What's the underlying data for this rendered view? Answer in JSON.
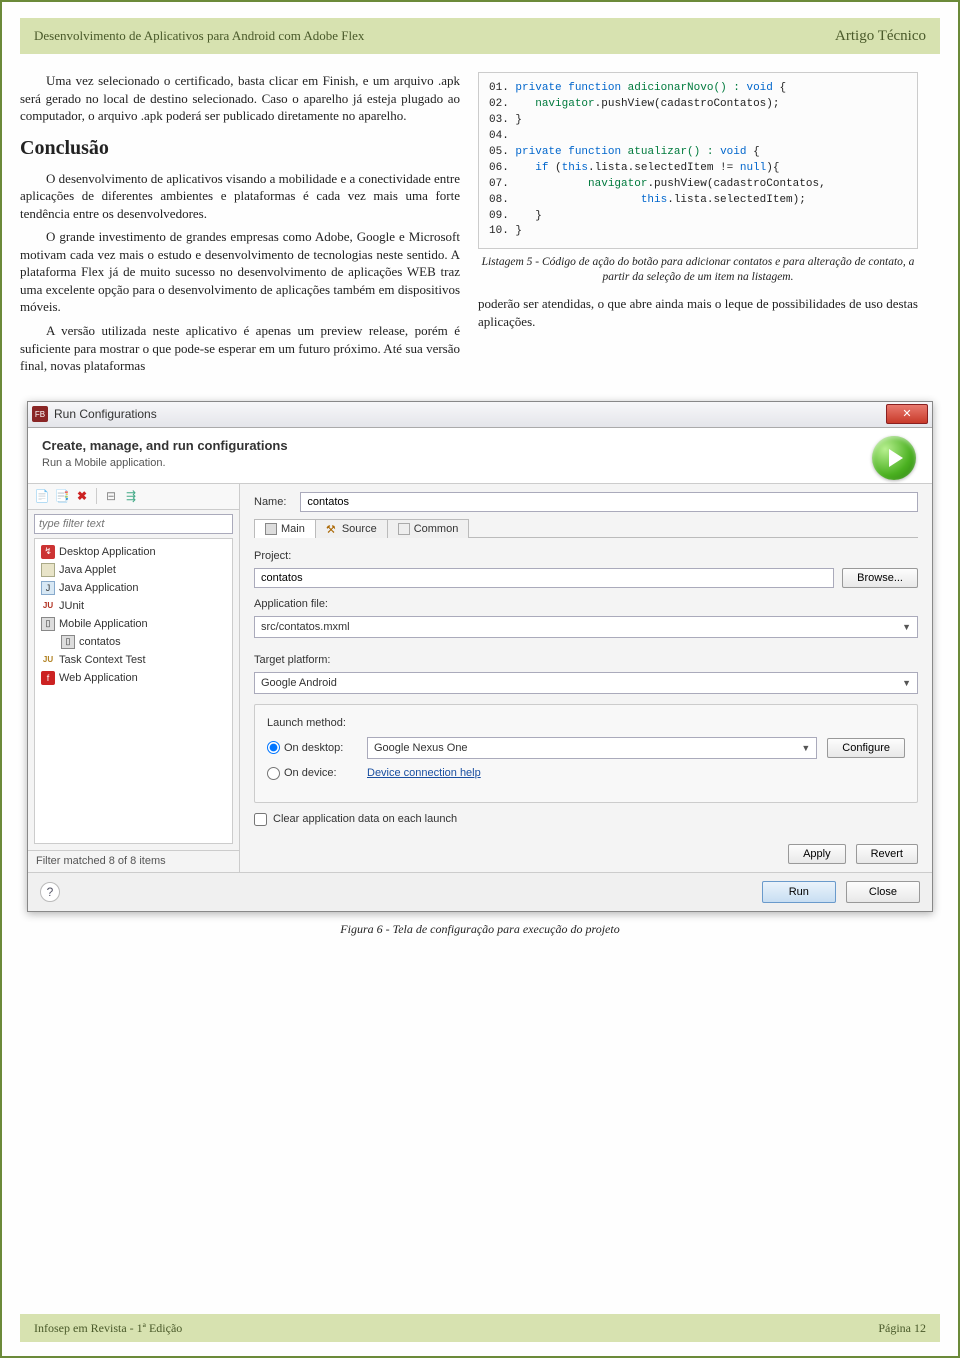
{
  "header": {
    "left": "Desenvolvimento de Aplicativos para Android com Adobe Flex",
    "right": "Artigo Técnico"
  },
  "left_col": {
    "p1": "Uma vez selecionado o certificado, basta clicar em Finish, e um arquivo .apk será gerado no local de destino selecionado. Caso o aparelho já esteja plugado ao computador, o arquivo .apk poderá ser publicado diretamente no aparelho.",
    "h2": "Conclusão",
    "p2": "O desenvolvimento de aplicativos visando a mobilidade e a conectividade entre aplicações de diferentes ambientes e plataformas é cada vez mais uma forte tendência entre os desenvolvedores.",
    "p3": "O grande investimento de grandes empresas como Adobe, Google e Microsoft motivam cada vez mais o estudo e desenvolvimento de tecnologias neste sentido. A plataforma Flex já de muito sucesso no desenvolvimento de aplicações WEB traz uma excelente opção para o desenvolvimento de aplicações também em dispositivos móveis.",
    "p4": "A versão utilizada neste aplicativo é apenas um preview release, porém é suficiente para mostrar o que pode-se esperar em um futuro próximo. Até sua versão final, novas plataformas"
  },
  "code": {
    "l01a": "01.",
    "l01b": "private function",
    "l01c": " adicionarNovo() : ",
    "l01d": "void",
    "l01e": " {",
    "l02a": "02.    ",
    "l02b": "navigator",
    "l02c": ".pushView(cadastroContatos);",
    "l03": "03. }",
    "l04": "04.",
    "l05a": "05.",
    "l05b": "private function",
    "l05c": " atualizar() : ",
    "l05d": "void",
    "l05e": " {",
    "l06a": "06.    ",
    "l06b": "if",
    "l06c": " (",
    "l06d": "this",
    "l06e": ".lista.selectedItem != ",
    "l06f": "null",
    "l06g": "){",
    "l07a": "07.            ",
    "l07b": "navigator",
    "l07c": ".pushView(cadastroContatos,",
    "l08a": "08.                    ",
    "l08b": "this",
    "l08c": ".lista.selectedItem);",
    "l09": "09.    }",
    "l10": "10. }"
  },
  "caption5": "Listagem 5 - Código de ação do botão para adicionar contatos e para alteração de contato, a partir da seleção de um item na listagem.",
  "right_p": "poderão ser atendidas, o que abre ainda mais o leque de possibilidades de uso destas aplicações.",
  "dialog": {
    "title": "Run Configurations",
    "head_h": "Create, manage, and run configurations",
    "head_p": "Run a Mobile application.",
    "filter_placeholder": "type filter text",
    "tree": [
      {
        "label": "Desktop Application"
      },
      {
        "label": "Java Applet"
      },
      {
        "label": "Java Application"
      },
      {
        "label": "JUnit"
      },
      {
        "label": "Mobile Application"
      },
      {
        "label": "contatos",
        "child": true
      },
      {
        "label": "Task Context Test"
      },
      {
        "label": "Web Application"
      }
    ],
    "filter_status": "Filter matched 8 of 8 items",
    "name_label": "Name:",
    "name_value": "contatos",
    "tabs": [
      "Main",
      "Source",
      "Common"
    ],
    "project_label": "Project:",
    "project_value": "contatos",
    "browse": "Browse...",
    "appfile_label": "Application file:",
    "appfile_value": "src/contatos.mxml",
    "target_label": "Target platform:",
    "target_value": "Google Android",
    "launch_label": "Launch method:",
    "on_desktop": "On desktop:",
    "desktop_value": "Google Nexus One",
    "configure": "Configure",
    "on_device": "On device:",
    "device_link": "Device connection help",
    "clear_label": "Clear application data on each launch",
    "apply": "Apply",
    "revert": "Revert",
    "run": "Run",
    "close": "Close"
  },
  "fig6": "Figura 6 - Tela de configuração para execução do projeto",
  "footer": {
    "left": "Infosep em Revista - 1ª Edição",
    "right": "Página 12"
  }
}
